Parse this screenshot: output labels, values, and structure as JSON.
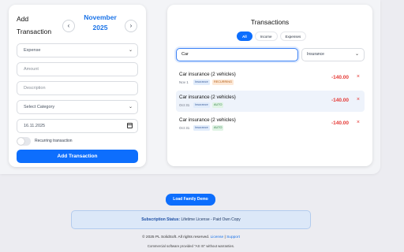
{
  "add_transaction": {
    "title": "Add Transaction",
    "month": "November 2025",
    "prev_icon": "chevron-left-icon",
    "next_icon": "chevron-right-icon",
    "type_value": "Expense",
    "amount_placeholder": "Amount",
    "description_placeholder": "Description",
    "category_placeholder": "Select Category",
    "date_value": "16.11.2025",
    "recurring_label": "Recurring transaction",
    "recurring_on": false,
    "submit_label": "Add Transaction"
  },
  "transactions": {
    "title": "Transactions",
    "filters": [
      "All",
      "Income",
      "Expenses"
    ],
    "active_filter": "All",
    "search_value": "Car",
    "category_filter": "Insurance",
    "items": [
      {
        "name": "Car insurance (2 vehicles)",
        "date": "Nov 1",
        "tags": [
          "Insurance",
          "RECURRING"
        ],
        "amount": "-140.00"
      },
      {
        "name": "Car insurance (2 vehicles)",
        "date": "Oct 31",
        "tags": [
          "Insurance",
          "AUTO"
        ],
        "amount": "-140.00"
      },
      {
        "name": "Car insurance (2 vehicles)",
        "date": "Oct 31",
        "tags": [
          "Insurance",
          "AUTO"
        ],
        "amount": "-140.00"
      }
    ],
    "delete_symbol": "×"
  },
  "footer": {
    "demo_button": "Load Family Demo",
    "status_label": "Subscription Status:",
    "status_value": "Lifetime License - Paid Own Copy",
    "copyright": "© 2025 PL SolidSoft. All rights reserved.",
    "license_link": "License",
    "separator": "|",
    "support_link": "Support",
    "warranty": "Commercial software provided \"AS IS\" without warranties."
  },
  "colors": {
    "accent": "#0d6efd",
    "month": "#1a73e8",
    "expense": "#e53935",
    "status_bg": "#dce8f8"
  }
}
